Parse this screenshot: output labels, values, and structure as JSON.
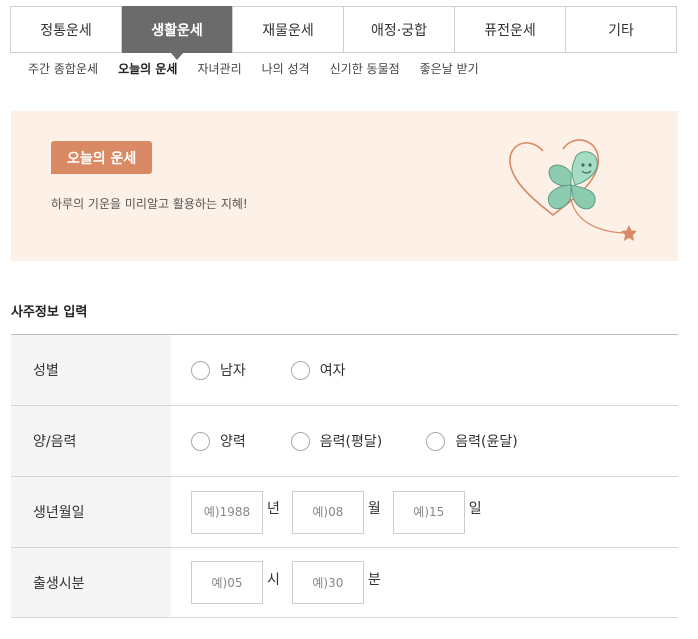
{
  "tabs": [
    {
      "label": "정통운세",
      "active": false
    },
    {
      "label": "생활운세",
      "active": true
    },
    {
      "label": "재물운세",
      "active": false
    },
    {
      "label": "애정·궁합",
      "active": false
    },
    {
      "label": "퓨전운세",
      "active": false
    },
    {
      "label": "기타",
      "active": false
    }
  ],
  "subnav": [
    {
      "label": "주간 종합운세",
      "active": false
    },
    {
      "label": "오늘의 운세",
      "active": true
    },
    {
      "label": "자녀관리",
      "active": false
    },
    {
      "label": "나의 성격",
      "active": false
    },
    {
      "label": "신기한 동물점",
      "active": false
    },
    {
      "label": "좋은날 받기",
      "active": false
    }
  ],
  "banner": {
    "badge": "오늘의 운세",
    "description": "하루의 기운을 미리알고 활용하는 지혜!",
    "colors": {
      "background": "#fdf0e6",
      "badge": "#d98964",
      "clover": "#8ccbb0",
      "star": "#d98964"
    }
  },
  "section_title": "사주정보 입력",
  "form": {
    "gender": {
      "label": "성별",
      "options": [
        "남자",
        "여자"
      ]
    },
    "calendar": {
      "label": "양/음력",
      "options": [
        "양력",
        "음력(평달)",
        "음력(윤달)"
      ]
    },
    "birthdate": {
      "label": "생년월일",
      "year_placeholder": "예)1988",
      "year_unit": "년",
      "month_placeholder": "예)08",
      "month_unit": "월",
      "day_placeholder": "예)15",
      "day_unit": "일"
    },
    "birthtime": {
      "label": "출생시분",
      "hour_placeholder": "예)05",
      "hour_unit": "시",
      "minute_placeholder": "예)30",
      "minute_unit": "분"
    }
  }
}
